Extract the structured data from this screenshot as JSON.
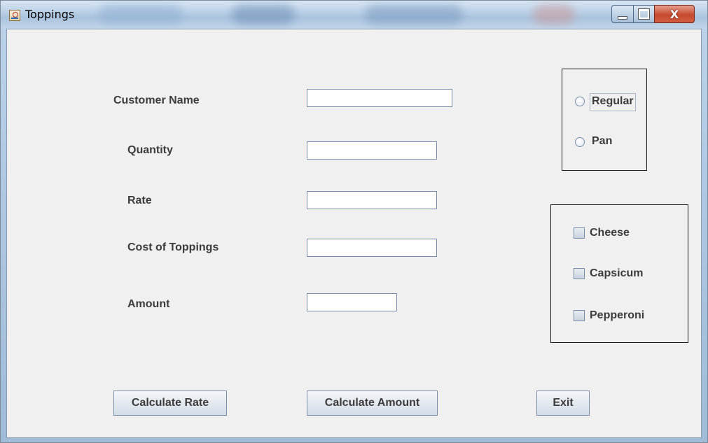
{
  "window": {
    "title": "Toppings",
    "controls": {
      "minimize": "minimize",
      "maximize": "maximize",
      "close": "X"
    }
  },
  "form": {
    "customer_name": {
      "label": "Customer Name",
      "value": ""
    },
    "quantity": {
      "label": "Quantity",
      "value": ""
    },
    "rate": {
      "label": "Rate",
      "value": ""
    },
    "cost_of_toppings": {
      "label": "Cost of Toppings",
      "value": ""
    },
    "amount": {
      "label": "Amount",
      "value": ""
    }
  },
  "crust": {
    "options": [
      {
        "label": "Regular",
        "selected": false
      },
      {
        "label": "Pan",
        "selected": false
      }
    ]
  },
  "toppings": {
    "options": [
      {
        "label": "Cheese",
        "checked": false
      },
      {
        "label": "Capsicum",
        "checked": false
      },
      {
        "label": "Pepperoni",
        "checked": false
      }
    ]
  },
  "buttons": {
    "calculate_rate": "Calculate Rate",
    "calculate_amount": "Calculate Amount",
    "exit": "Exit"
  },
  "icons": {
    "app": "java-coffee-cup-icon",
    "minimize": "minimize-icon",
    "maximize": "maximize-icon",
    "close": "close-icon"
  }
}
